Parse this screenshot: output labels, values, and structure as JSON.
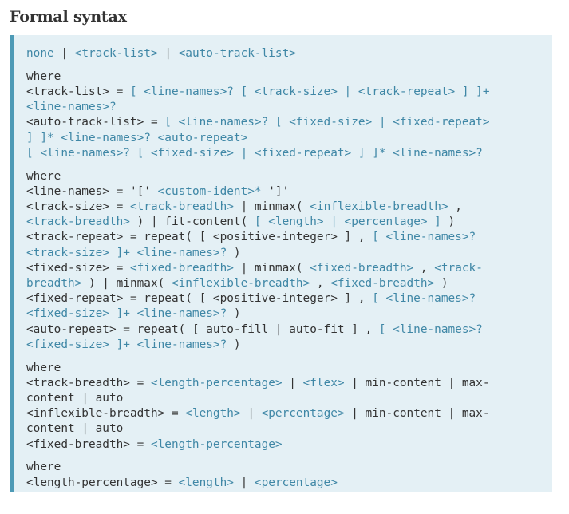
{
  "section": {
    "title": "Formal syntax"
  },
  "syntax": {
    "groups": [
      [
        [
          [
            "link",
            "none"
          ],
          [
            "text",
            " | "
          ],
          [
            "link",
            "<track-list>"
          ],
          [
            "text",
            " | "
          ],
          [
            "link",
            "<auto-track-list>"
          ]
        ]
      ],
      [
        [
          [
            "text",
            "where"
          ]
        ],
        [
          [
            "text",
            "<track-list> = "
          ],
          [
            "link",
            "[ <line-names>? [ <track-size> | <track-repeat> ] ]+"
          ]
        ],
        [
          [
            "link",
            "<line-names>?"
          ]
        ],
        [
          [
            "text",
            "<auto-track-list> = "
          ],
          [
            "link",
            "[ <line-names>? [ <fixed-size> | <fixed-repeat>"
          ]
        ],
        [
          [
            "link",
            "] ]* <line-names>? <auto-repeat>"
          ]
        ],
        [
          [
            "link",
            "[ <line-names>? [ <fixed-size> | <fixed-repeat> ] ]* <line-names>?"
          ]
        ]
      ],
      [
        [
          [
            "text",
            "where"
          ]
        ],
        [
          [
            "text",
            "<line-names> = '[' "
          ],
          [
            "link",
            "<custom-ident>*"
          ],
          [
            "text",
            " ']'"
          ]
        ],
        [
          [
            "text",
            "<track-size> = "
          ],
          [
            "link",
            "<track-breadth>"
          ],
          [
            "text",
            " | minmax( "
          ],
          [
            "link",
            "<inflexible-breadth>"
          ],
          [
            "text",
            " ,"
          ]
        ],
        [
          [
            "link",
            "<track-breadth>"
          ],
          [
            "text",
            " ) | fit-content( "
          ],
          [
            "link",
            "[ <length> | <percentage> ]"
          ],
          [
            "text",
            " )"
          ]
        ],
        [
          [
            "text",
            "<track-repeat> = repeat( [ <positive-integer> ] , "
          ],
          [
            "link",
            "[ <line-names>?"
          ]
        ],
        [
          [
            "link",
            "<track-size> ]+ <line-names>?"
          ],
          [
            "text",
            " )"
          ]
        ],
        [
          [
            "text",
            "<fixed-size> = "
          ],
          [
            "link",
            "<fixed-breadth>"
          ],
          [
            "text",
            " | minmax( "
          ],
          [
            "link",
            "<fixed-breadth>"
          ],
          [
            "text",
            " , "
          ],
          [
            "link",
            "<track-"
          ]
        ],
        [
          [
            "link",
            "breadth>"
          ],
          [
            "text",
            " ) | minmax( "
          ],
          [
            "link",
            "<inflexible-breadth>"
          ],
          [
            "text",
            " , "
          ],
          [
            "link",
            "<fixed-breadth>"
          ],
          [
            "text",
            " )"
          ]
        ],
        [
          [
            "text",
            "<fixed-repeat> = repeat( [ <positive-integer> ] , "
          ],
          [
            "link",
            "[ <line-names>?"
          ]
        ],
        [
          [
            "link",
            "<fixed-size> ]+ <line-names>?"
          ],
          [
            "text",
            " )"
          ]
        ],
        [
          [
            "text",
            "<auto-repeat> = repeat( [ auto-fill | auto-fit ] , "
          ],
          [
            "link",
            "[ <line-names>?"
          ]
        ],
        [
          [
            "link",
            "<fixed-size> ]+ <line-names>?"
          ],
          [
            "text",
            " )"
          ]
        ]
      ],
      [
        [
          [
            "text",
            "where"
          ]
        ],
        [
          [
            "text",
            "<track-breadth> = "
          ],
          [
            "link",
            "<length-percentage>"
          ],
          [
            "text",
            " | "
          ],
          [
            "link",
            "<flex>"
          ],
          [
            "text",
            " | min-content | max-"
          ]
        ],
        [
          [
            "text",
            "content | auto"
          ]
        ],
        [
          [
            "text",
            "<inflexible-breadth> = "
          ],
          [
            "link",
            "<length>"
          ],
          [
            "text",
            " | "
          ],
          [
            "link",
            "<percentage>"
          ],
          [
            "text",
            " | min-content | max-"
          ]
        ],
        [
          [
            "text",
            "content | auto"
          ]
        ],
        [
          [
            "text",
            "<fixed-breadth> = "
          ],
          [
            "link",
            "<length-percentage>"
          ]
        ]
      ],
      [
        [
          [
            "text",
            "where"
          ]
        ],
        [
          [
            "text",
            "<length-percentage> = "
          ],
          [
            "link",
            "<length>"
          ],
          [
            "text",
            " | "
          ],
          [
            "link",
            "<percentage>"
          ]
        ]
      ]
    ]
  },
  "colors": {
    "box_background": "#e4f0f5",
    "box_border": "#4d9ab6",
    "link": "#3f87a6",
    "text": "#333333"
  }
}
